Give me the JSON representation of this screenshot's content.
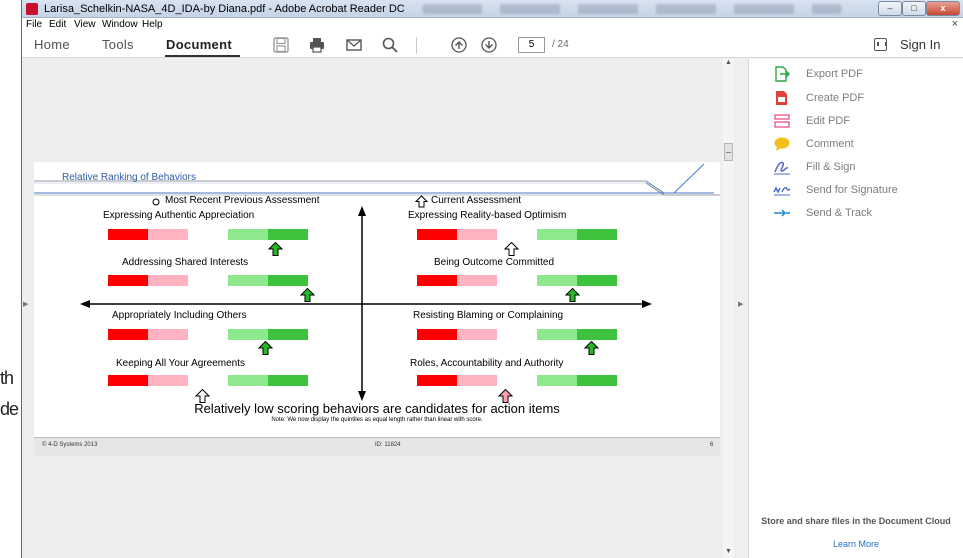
{
  "background": {
    "fragment_1": "th",
    "fragment_2": "de"
  },
  "window": {
    "title": "Larisa_Schelkin-NASA_4D_IDA-by Diana.pdf - Adobe Acrobat Reader DC",
    "controls": {
      "minimize": "–",
      "maximize": "□",
      "close": "x"
    }
  },
  "menu": {
    "items": [
      "File",
      "Edit",
      "View",
      "Window",
      "Help"
    ],
    "doc_close": "×"
  },
  "toolbar": {
    "tabs": [
      "Home",
      "Tools",
      "Document"
    ],
    "active_tab": "Document",
    "icons": [
      "save-icon",
      "print-icon",
      "email-icon",
      "search-icon",
      "page-up-icon",
      "page-down-icon"
    ],
    "current_page": "5",
    "total_pages": "/ 24",
    "sign_in": "Sign In"
  },
  "tools_pane": {
    "items": [
      {
        "label": "Export PDF",
        "icon": "export-pdf-icon",
        "color": "#2aa845"
      },
      {
        "label": "Create PDF",
        "icon": "create-pdf-icon",
        "color": "#e0423b"
      },
      {
        "label": "Edit PDF",
        "icon": "edit-pdf-icon",
        "color": "#e8518f"
      },
      {
        "label": "Comment",
        "icon": "comment-icon",
        "color": "#f2c018"
      },
      {
        "label": "Fill & Sign",
        "icon": "fill-sign-icon",
        "color": "#5a63c8"
      },
      {
        "label": "Send for Signature",
        "icon": "send-signature-icon",
        "color": "#4a68c9"
      },
      {
        "label": "Send & Track",
        "icon": "send-track-icon",
        "color": "#1c8fd6"
      }
    ],
    "cloud_text": "Store and share files in the Document Cloud",
    "learn_more": "Learn More"
  },
  "document_page": {
    "section_title": "Relative Ranking of Behaviors",
    "legend": {
      "previous": "Most Recent Previous Assessment",
      "current": "Current Assessment"
    },
    "behaviors": [
      {
        "label": "Expressing Authentic Appreciation",
        "marker": "up-arrow",
        "marker_color": "#22bb22",
        "quintile": 5
      },
      {
        "label": "Expressing Reality-based Optimism",
        "marker": "up-arrow",
        "marker_color": "#ffffff",
        "quintile": 3
      },
      {
        "label": "Addressing Shared Interests",
        "marker": "up-arrow",
        "marker_color": "#22bb22",
        "quintile": 5
      },
      {
        "label": "Being Outcome Committed",
        "marker": "up-arrow",
        "marker_color": "#22bb22",
        "quintile": 4
      },
      {
        "label": "Appropriately Including Others",
        "marker": "up-arrow",
        "marker_color": "#22bb22",
        "quintile": 4
      },
      {
        "label": "Resisting Blaming or Complaining",
        "marker": "up-arrow",
        "marker_color": "#22bb22",
        "quintile": 4
      },
      {
        "label": "Keeping All Your Agreements",
        "marker": "up-arrow",
        "marker_color": "#ffffff",
        "quintile": 2
      },
      {
        "label": "Roles, Accountability and Authority",
        "marker": "up-arrow",
        "marker_color": "#ff9fb1",
        "quintile": 2
      }
    ],
    "conclusion": "Relatively low scoring behaviors are candidates for action items",
    "note": "Note: We now display the quintiles as equal length rather than linear with score.",
    "footer_left": "© 4-D Systems 2013",
    "footer_id": "ID: 11824",
    "footer_page": "6",
    "quintile_colors": [
      "#ff0000",
      "#ffb3c1",
      "#ffffff",
      "#8ee88e",
      "#3cc23c"
    ]
  }
}
